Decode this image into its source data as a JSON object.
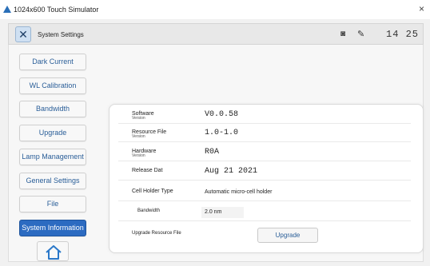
{
  "window": {
    "title": "1024x600 Touch Simulator",
    "close_glyph": "×",
    "app_icon": "triangle-logo-icon"
  },
  "header": {
    "title": "System Settings",
    "time": "14 25",
    "icons": [
      "tools-icon",
      "lamp-icon",
      "pencil-icon"
    ]
  },
  "nav": {
    "items": [
      {
        "label": "Dark Current"
      },
      {
        "label": "WL Calibration"
      },
      {
        "label": "Bandwidth"
      },
      {
        "label": "Upgrade"
      },
      {
        "label": "Lamp Management"
      },
      {
        "label": "General Settings"
      },
      {
        "label": "File"
      },
      {
        "label": "System Information",
        "active": true
      }
    ],
    "home_icon": "home-icon",
    "active_color": "#2c6bc1"
  },
  "info": {
    "software": {
      "label": "Software",
      "sub": "Version",
      "value": "V0.0.58"
    },
    "resource": {
      "label": "Resource File",
      "sub": "Version",
      "value": "1.0-1.0"
    },
    "hardware": {
      "label": "Hardware",
      "sub": "Version",
      "value": "R0A"
    },
    "release": {
      "label": "Release Dat",
      "value": "Aug 21 2021"
    },
    "cell_holder": {
      "label": "Cell Holder Type",
      "value": "Automatic micro-cell holder"
    },
    "bandwidth": {
      "label": "Bandwidth",
      "value": "2.0 nm"
    },
    "upgrade_resource": {
      "label": "Upgrade Resource File",
      "button": "Upgrade"
    }
  }
}
